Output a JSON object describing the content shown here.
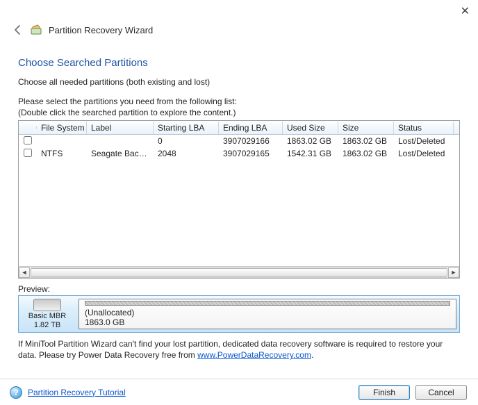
{
  "close_label": "✕",
  "header": {
    "title": "Partition Recovery Wizard"
  },
  "section_title": "Choose Searched Partitions",
  "choose_line": "Choose all needed partitions (both existing and lost)",
  "instructions": [
    "Please select the partitions you need from the following list:",
    "(Double click the searched partition to explore the content.)"
  ],
  "table": {
    "columns": [
      "File System",
      "Label",
      "Starting LBA",
      "Ending LBA",
      "Used Size",
      "Size",
      "Status"
    ],
    "rows": [
      {
        "fs": "",
        "label": "",
        "slba": "0",
        "elba": "3907029166",
        "used": "1863.02 GB",
        "size": "1863.02 GB",
        "status": "Lost/Deleted"
      },
      {
        "fs": "NTFS",
        "label": "Seagate Backup...",
        "slba": "2048",
        "elba": "3907029165",
        "used": "1542.31 GB",
        "size": "1863.02 GB",
        "status": "Lost/Deleted"
      }
    ]
  },
  "preview_label": "Preview:",
  "preview": {
    "disk_type": "Basic MBR",
    "disk_size": "1.82 TB",
    "partition_name": "(Unallocated)",
    "partition_size": "1863.0 GB"
  },
  "help": {
    "text_1": "If MiniTool Partition Wizard can't find your lost partition, dedicated data recovery software is required to restore your data. Please try Power Data Recovery free from ",
    "link": "www.PowerDataRecovery.com",
    "text_2": "."
  },
  "footer": {
    "tutorial_link": "Partition Recovery Tutorial",
    "finish": "Finish",
    "cancel": "Cancel"
  }
}
